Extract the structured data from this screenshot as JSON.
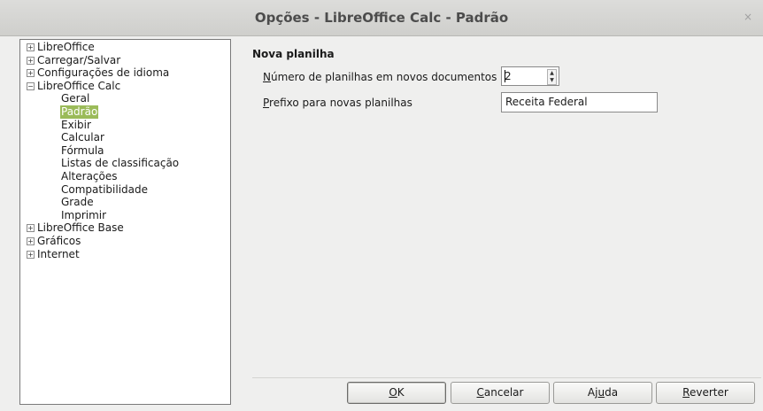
{
  "window": {
    "title": "Opções - LibreOffice Calc - Padrão",
    "close_glyph": "×"
  },
  "tree": {
    "nodes": [
      {
        "label": "LibreOffice",
        "expander": "+",
        "level": 0,
        "selected": false
      },
      {
        "label": "Carregar/Salvar",
        "expander": "+",
        "level": 0,
        "selected": false
      },
      {
        "label": "Configurações de idioma",
        "expander": "+",
        "level": 0,
        "selected": false
      },
      {
        "label": "LibreOffice Calc",
        "expander": "−",
        "level": 0,
        "selected": false
      },
      {
        "label": "Geral",
        "expander": "",
        "level": 1,
        "selected": false
      },
      {
        "label": "Padrão",
        "expander": "",
        "level": 1,
        "selected": true
      },
      {
        "label": "Exibir",
        "expander": "",
        "level": 1,
        "selected": false
      },
      {
        "label": "Calcular",
        "expander": "",
        "level": 1,
        "selected": false
      },
      {
        "label": "Fórmula",
        "expander": "",
        "level": 1,
        "selected": false
      },
      {
        "label": "Listas de classificação",
        "expander": "",
        "level": 1,
        "selected": false
      },
      {
        "label": "Alterações",
        "expander": "",
        "level": 1,
        "selected": false
      },
      {
        "label": "Compatibilidade",
        "expander": "",
        "level": 1,
        "selected": false
      },
      {
        "label": "Grade",
        "expander": "",
        "level": 1,
        "selected": false
      },
      {
        "label": "Imprimir",
        "expander": "",
        "level": 1,
        "selected": false
      },
      {
        "label": "LibreOffice Base",
        "expander": "+",
        "level": 0,
        "selected": false
      },
      {
        "label": "Gráficos",
        "expander": "+",
        "level": 0,
        "selected": false
      },
      {
        "label": "Internet",
        "expander": "+",
        "level": 0,
        "selected": false
      }
    ]
  },
  "panel": {
    "section_title": "Nova planilha",
    "sheets_label_mnemonic": "N",
    "sheets_label_rest": "úmero de planilhas em novos documentos",
    "sheets_value": "2",
    "prefix_label_mnemonic": "P",
    "prefix_label_rest": "refixo para novas planilhas",
    "prefix_value": "Receita Federal"
  },
  "buttons": {
    "ok_mnemonic": "O",
    "ok_rest": "K",
    "cancel_mnemonic": "C",
    "cancel_rest": "ancelar",
    "help_pre": "Aj",
    "help_mnemonic": "u",
    "help_rest": "da",
    "revert_mnemonic": "R",
    "revert_rest": "everter"
  },
  "colors": {
    "selection": "#9bbb59",
    "window_bg": "#efefee"
  }
}
